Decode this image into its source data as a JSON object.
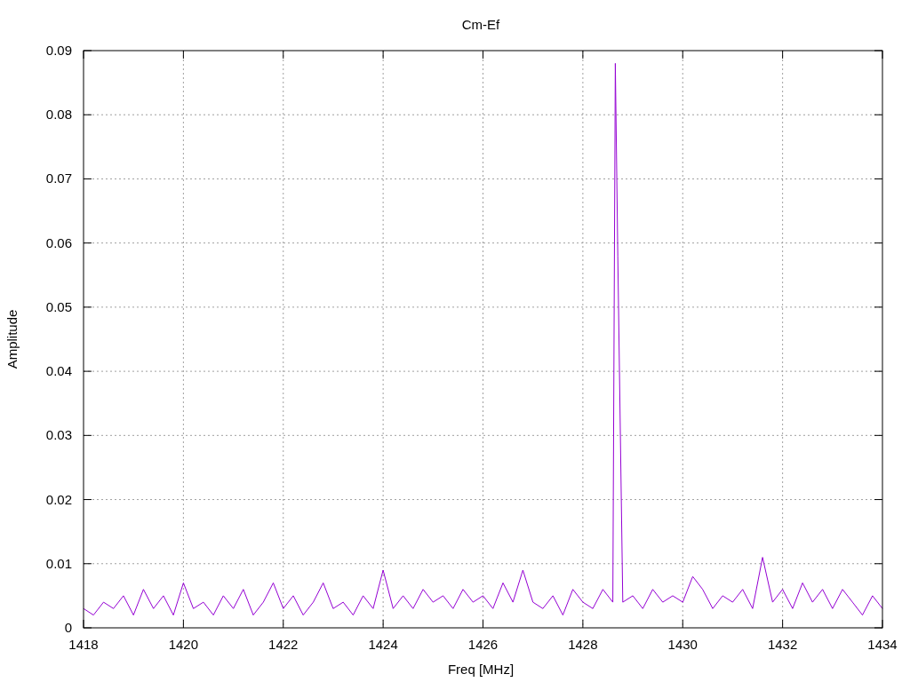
{
  "chart_data": {
    "type": "line",
    "title": "Cm-Ef",
    "xlabel": "Freq [MHz]",
    "ylabel": "Amplitude",
    "xlim": [
      1418,
      1434
    ],
    "ylim": [
      0,
      0.09
    ],
    "grid": true,
    "xticks": [
      1418,
      1420,
      1422,
      1424,
      1426,
      1428,
      1430,
      1432,
      1434
    ],
    "yticks": [
      0,
      0.01,
      0.02,
      0.03,
      0.04,
      0.05,
      0.06,
      0.07,
      0.08,
      0.09
    ],
    "x": [
      1418,
      1418.2,
      1418.4,
      1418.6,
      1418.8,
      1419,
      1419.2,
      1419.4,
      1419.6,
      1419.8,
      1420,
      1420.2,
      1420.4,
      1420.6,
      1420.8,
      1421,
      1421.2,
      1421.4,
      1421.6,
      1421.8,
      1422,
      1422.2,
      1422.4,
      1422.6,
      1422.8,
      1423,
      1423.2,
      1423.4,
      1423.6,
      1423.8,
      1424,
      1424.2,
      1424.4,
      1424.6,
      1424.8,
      1425,
      1425.2,
      1425.4,
      1425.6,
      1425.8,
      1426,
      1426.2,
      1426.4,
      1426.6,
      1426.8,
      1427,
      1427.2,
      1427.4,
      1427.6,
      1427.8,
      1428,
      1428.2,
      1428.4,
      1428.6,
      1428.65,
      1428.7,
      1428.8,
      1429,
      1429.2,
      1429.4,
      1429.6,
      1429.8,
      1430,
      1430.2,
      1430.4,
      1430.6,
      1430.8,
      1431,
      1431.2,
      1431.4,
      1431.6,
      1431.8,
      1432,
      1432.2,
      1432.4,
      1432.6,
      1432.8,
      1433,
      1433.2,
      1433.4,
      1433.6,
      1433.8,
      1434
    ],
    "series": [
      {
        "color": "#9400d3",
        "values": [
          0.003,
          0.002,
          0.004,
          0.003,
          0.005,
          0.002,
          0.006,
          0.003,
          0.005,
          0.002,
          0.007,
          0.003,
          0.004,
          0.002,
          0.005,
          0.003,
          0.006,
          0.002,
          0.004,
          0.007,
          0.003,
          0.005,
          0.002,
          0.004,
          0.007,
          0.003,
          0.004,
          0.002,
          0.005,
          0.003,
          0.009,
          0.003,
          0.005,
          0.003,
          0.006,
          0.004,
          0.005,
          0.003,
          0.006,
          0.004,
          0.005,
          0.003,
          0.007,
          0.004,
          0.009,
          0.004,
          0.003,
          0.005,
          0.002,
          0.006,
          0.004,
          0.003,
          0.006,
          0.004,
          0.088,
          0.058,
          0.004,
          0.005,
          0.003,
          0.006,
          0.004,
          0.005,
          0.004,
          0.008,
          0.006,
          0.003,
          0.005,
          0.004,
          0.006,
          0.003,
          0.011,
          0.004,
          0.006,
          0.003,
          0.007,
          0.004,
          0.006,
          0.003,
          0.006,
          0.004,
          0.002,
          0.005,
          0.003
        ]
      }
    ]
  }
}
